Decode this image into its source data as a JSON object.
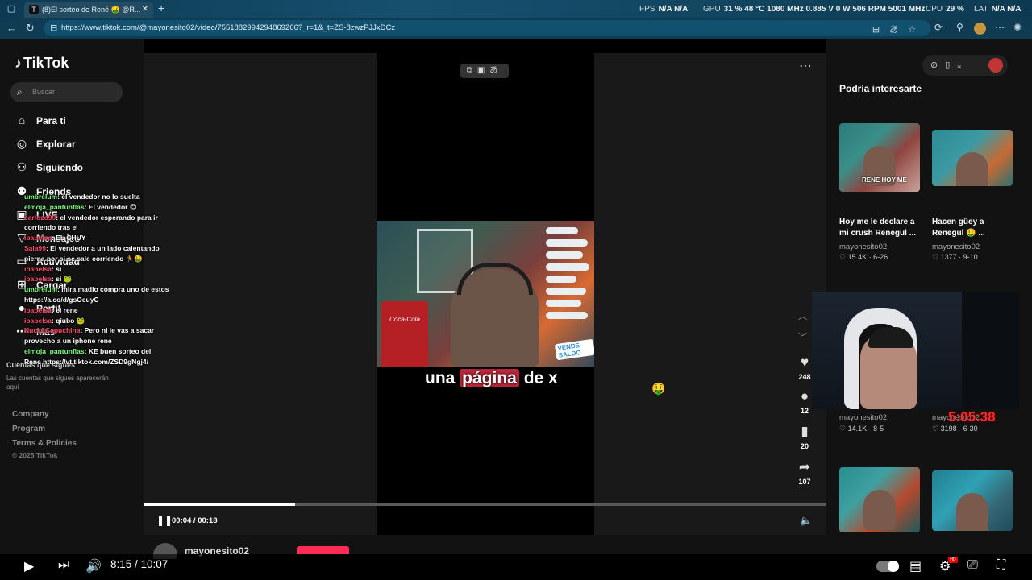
{
  "browser": {
    "tab_title": "(8)El sorteo de René 🤑 @R...",
    "tab_icon": "T",
    "url": "https://www.tiktok.com/@mayonesito02/video/7551882994294869266?_r=1&_t=ZS-8zwzPJJxDCz",
    "hud": {
      "fps_label": "FPS",
      "fps_value": "N/A N/A",
      "gpu_label": "GPU",
      "gpu_value": "31 % 48 °C 1080 MHz 0.885 V 0 W 506 RPM 5001 MHz",
      "cpu_label": "CPU",
      "cpu_value": "29 %",
      "lat_label": "LAT",
      "lat_value": "N/A N/A"
    }
  },
  "sidebar": {
    "logo": "TikTok",
    "search_placeholder": "Buscar",
    "nav": [
      {
        "label": "Para ti",
        "icon": "home-icon"
      },
      {
        "label": "Explorar",
        "icon": "compass-icon"
      },
      {
        "label": "Siguiendo",
        "icon": "following-icon"
      },
      {
        "label": "Friends",
        "icon": "friends-icon"
      },
      {
        "label": "LIVE",
        "icon": "live-icon"
      },
      {
        "label": "Mensajes",
        "icon": "messages-icon"
      },
      {
        "label": "Actividad",
        "icon": "activity-icon"
      },
      {
        "label": "Cargar",
        "icon": "upload-icon"
      },
      {
        "label": "Perfil",
        "icon": "profile-icon"
      },
      {
        "label": "Más",
        "icon": "more-icon"
      }
    ],
    "followed_heading": "Cuentas que sigues",
    "followed_text": "Las cuentas que sigues aparecerán aquí",
    "footer": [
      "Company",
      "Program",
      "Terms & Policies"
    ],
    "copyright": "© 2025 TikTok"
  },
  "video": {
    "caption_pre": "una ",
    "caption_highlight": "página",
    "caption_post": " de x",
    "fridge_text": "Coca-Cola",
    "overlay_badge": "VENDE SALDO",
    "time": "00:04 / 00:18",
    "progress_fraction": 0.222,
    "likes": "248",
    "comments": "12",
    "saves": "20",
    "shares": "107",
    "author": "mayonesito02"
  },
  "recommended": {
    "title": "Podría interesarte",
    "items": [
      {
        "caption": "Hoy me le declare a mi crush Renegul ...",
        "author": "mayonesito02",
        "likes": "15.4K",
        "date": "6-26",
        "thumb_label": "RENE HOY ME"
      },
      {
        "caption": "Hacen güey a Renegul 🤑 ...",
        "author": "mayonesito02",
        "likes": "1377",
        "date": "9-10",
        "thumb_label": ""
      },
      {
        "caption": "",
        "author": "mayonesito02",
        "likes": "14.1K",
        "date": "8-5",
        "thumb_label": ""
      },
      {
        "caption": "",
        "author": "mayonesito02",
        "likes": "3198",
        "date": "6-30",
        "thumb_label": ""
      }
    ]
  },
  "stream": {
    "timer": "5:05:38",
    "chat": [
      {
        "user": "umbrelum",
        "color": "#7cff7c",
        "text": ": el vendedor no lo suelta"
      },
      {
        "user": "elmoja_pantunflas",
        "color": "#7cff7c",
        "text": ": El vendedor 😋"
      },
      {
        "user": "carlozo99",
        "color": "#ff4d6d",
        "text": ": el vendedor esperando para ir corriendo tras el"
      },
      {
        "user": "ibabelsa",
        "color": "#ff4d6d",
        "text": ": EL CHUY"
      },
      {
        "user": "Sala99",
        "color": "#ff4d6d",
        "text": ": El vendedor a un lado calentando pierna por si se sale corriendo 🏃🤑"
      },
      {
        "user": "ibabelsa",
        "color": "#ff4d6d",
        "text": ": si"
      },
      {
        "user": "ibabelsa",
        "color": "#ff4d6d",
        "text": ": si 🐸"
      },
      {
        "user": "umbrelum",
        "color": "#7cff7c",
        "text": ": mira madio compra uno de estos https://a.co/d/gsOcuyC"
      },
      {
        "user": "ibabelsa",
        "color": "#ff4d6d",
        "text": ": el rene"
      },
      {
        "user": "ibabelsa",
        "color": "#ff4d6d",
        "text": ": qiubo 🐸"
      },
      {
        "user": "NucitaCapuchina",
        "color": "#ff4d6d",
        "text": ": Pero ni le vas a sacar provecho a un iphone rene"
      },
      {
        "user": "elmoja_pantunflas",
        "color": "#7cff7c",
        "text": ": KE buen sorteo del Rene https://vt.tiktok.com/ZSD9gNgj4/"
      }
    ]
  },
  "youtube": {
    "time": "8:15 / 10:07"
  }
}
